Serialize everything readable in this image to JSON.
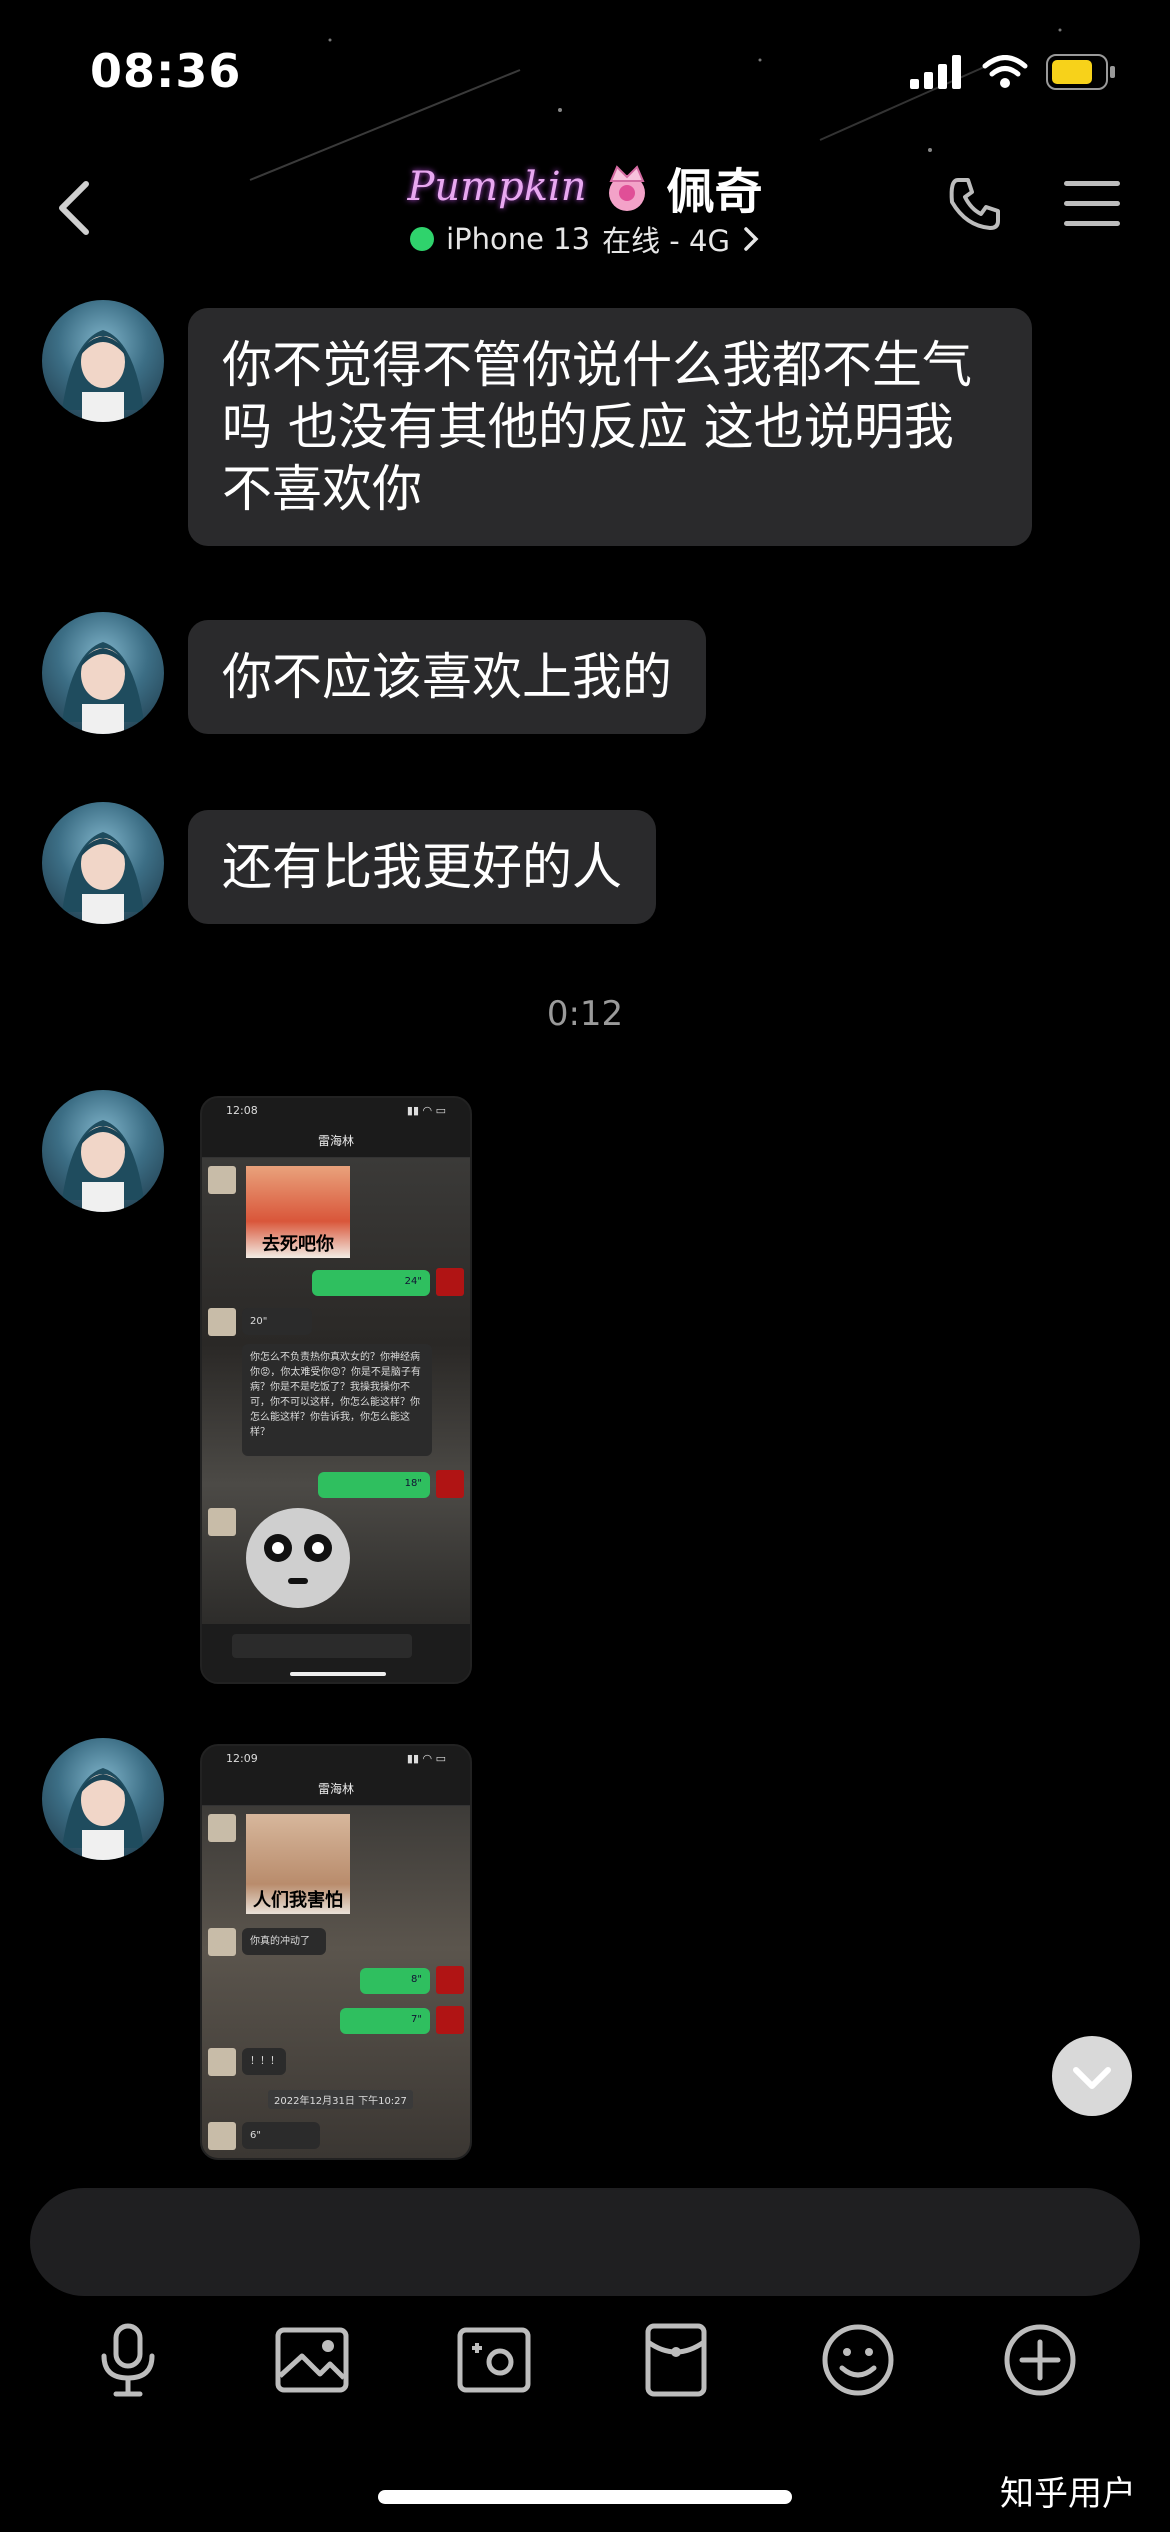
{
  "status_bar": {
    "time": "08:36"
  },
  "header": {
    "brand_logo": "Pumpkin",
    "title": "佩奇",
    "device": "iPhone 13",
    "status": "在线 - 4G"
  },
  "messages": [
    {
      "type": "text",
      "text": "你不觉得不管你说什么我都不生气吗 也没有其他的反应 这也说明我不喜欢你"
    },
    {
      "type": "text",
      "text": "你不应该喜欢上我的"
    },
    {
      "type": "text",
      "text": "还有比我更好的人"
    }
  ],
  "timestamp": "0:12",
  "screenshot1": {
    "time": "12:08",
    "contact": "雷海林",
    "meme_caption": "去死吧你",
    "voice_a": "24\"",
    "voice_b": "20\"",
    "long_text": "你怎么不负责热你真欢女的？你神经病你😡，你太难受你😡？你是不是脑子有病？你是不是吃饭了？我操我操你不可，你不可以这样，你怎么能这样？你怎么能这样？你告诉我，你怎么能这样？",
    "voice_c": "18\""
  },
  "screenshot2": {
    "time": "12:09",
    "contact": "雷海林",
    "meme_caption": "人们我害怕",
    "text_a": "你真的冲动了",
    "voice_a": "8\"",
    "voice_b": "7\"",
    "text_b": "！！！",
    "date": "2022年12月31日 下午10:27",
    "voice_c": "6\""
  },
  "watermark": "知乎用户"
}
